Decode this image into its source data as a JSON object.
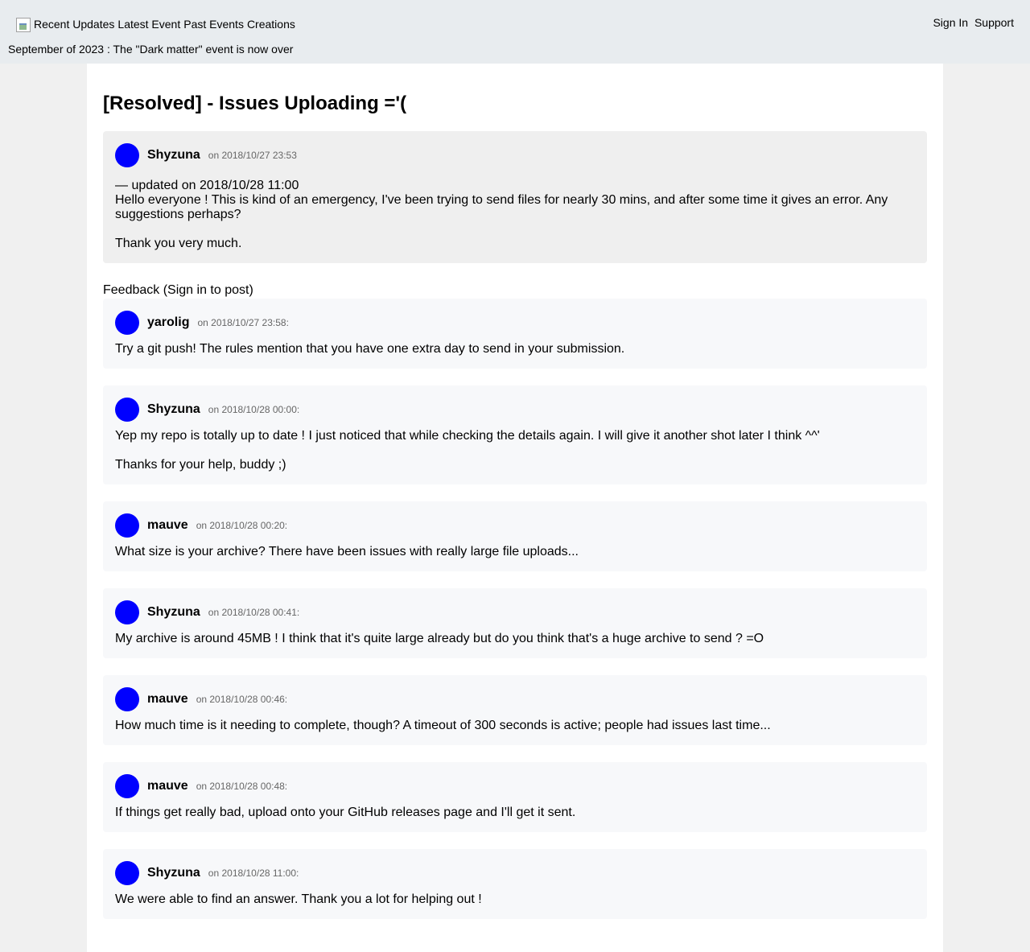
{
  "nav": {
    "items": [
      "Recent Updates",
      "Latest Event",
      "Past Events",
      "Creations"
    ],
    "right_items": [
      "Sign In",
      "Support"
    ],
    "banner": "September of 2023 : The \"Dark matter\" event is now over"
  },
  "page_title": "[Resolved] - Issues Uploading ='(",
  "original_post": {
    "author": "Shyzuna",
    "time": "on 2018/10/27 23:53",
    "updated": "— updated on 2018/10/28 11:00",
    "paragraphs": [
      "Hello everyone ! This is kind of an emergency, I've been trying to send files for nearly 30 mins, and after some time it gives an error. Any suggestions perhaps?",
      "Thank you very much."
    ]
  },
  "feedback_label": "Feedback (Sign in to post)",
  "replies": [
    {
      "author": "yarolig",
      "time": "on 2018/10/27 23:58:",
      "paragraphs": [
        "Try a git push! The rules mention that you have one extra day to send in your submission."
      ]
    },
    {
      "author": "Shyzuna",
      "time": "on 2018/10/28 00:00:",
      "paragraphs": [
        "Yep my repo is totally up to date ! I just noticed that while checking the details again. I will give it another shot later I think ^^'",
        "Thanks for your help, buddy ;)"
      ]
    },
    {
      "author": "mauve",
      "time": "on 2018/10/28 00:20:",
      "paragraphs": [
        "What size is your archive? There have been issues with really large file uploads..."
      ]
    },
    {
      "author": "Shyzuna",
      "time": "on 2018/10/28 00:41:",
      "paragraphs": [
        "My archive is around 45MB ! I think that it's quite large already but do you think that's a huge archive to send ? =O"
      ]
    },
    {
      "author": "mauve",
      "time": "on 2018/10/28 00:46:",
      "paragraphs": [
        "How much time is it needing to complete, though? A timeout of 300 seconds is active; people had issues last time..."
      ]
    },
    {
      "author": "mauve",
      "time": "on 2018/10/28 00:48:",
      "paragraphs": [
        "If things get really bad, upload onto your GitHub releases page and I'll get it sent."
      ]
    },
    {
      "author": "Shyzuna",
      "time": "on 2018/10/28 11:00:",
      "paragraphs": [
        "We were able to find an answer. Thank you a lot for helping out !"
      ]
    }
  ],
  "colors": {
    "avatar": "#0000ff",
    "topbar": "#e8ecef",
    "original_post_bg": "#efefef",
    "reply_bg": "#f7f8fa"
  }
}
